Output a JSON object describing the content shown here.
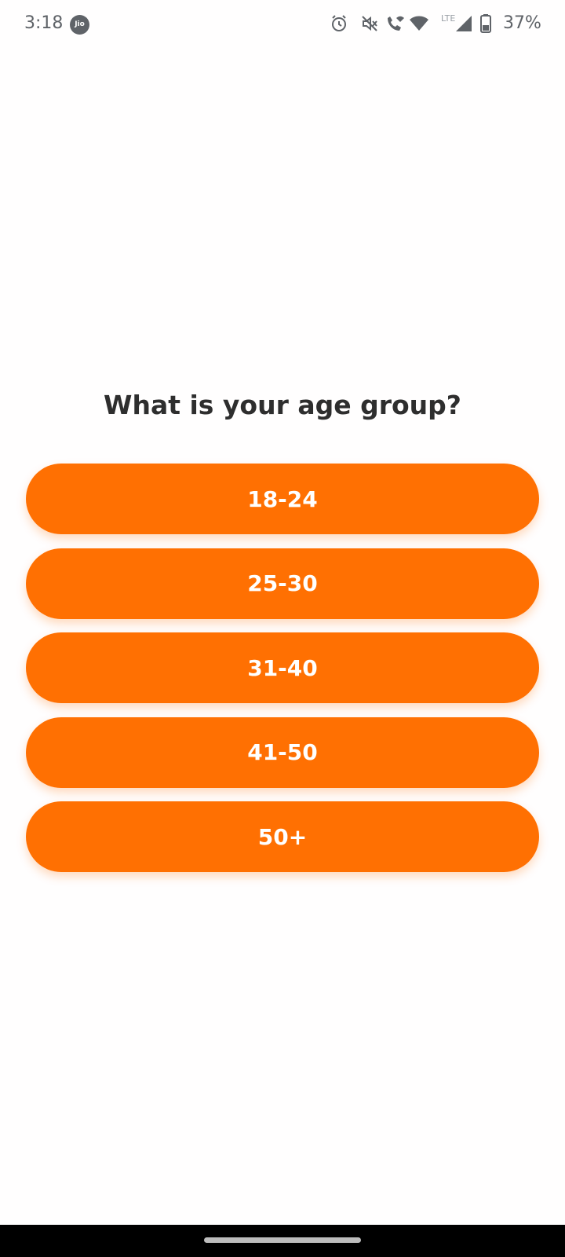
{
  "status_bar": {
    "time": "3:18",
    "carrier": "Jio",
    "network_type": "LTE",
    "battery": "37%",
    "icons": [
      "alarm-icon",
      "mute-icon",
      "wifi-calling-icon",
      "wifi-icon",
      "cell-signal-icon",
      "battery-icon"
    ]
  },
  "question": {
    "text": "What is your age group?"
  },
  "options": [
    {
      "label": "18-24"
    },
    {
      "label": "25-30"
    },
    {
      "label": "31-40"
    },
    {
      "label": "41-50"
    },
    {
      "label": "50+"
    }
  ],
  "colors": {
    "accent": "#ff7002",
    "background": "#fffefe",
    "text": "#2e2e2e"
  }
}
